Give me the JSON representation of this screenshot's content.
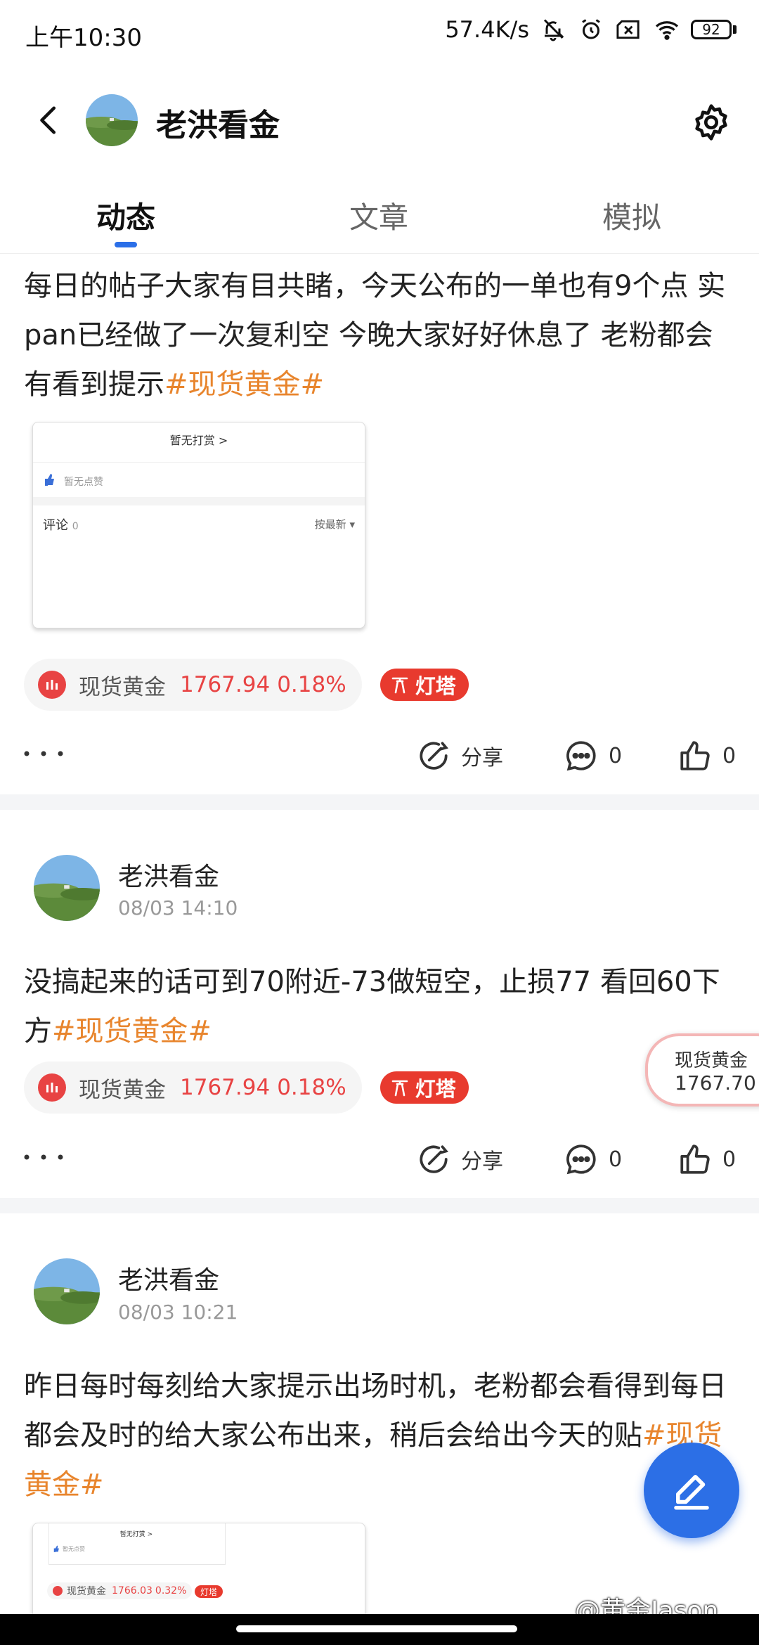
{
  "status_bar": {
    "time": "上午10:30",
    "speed": "57.4K/s",
    "battery": "92"
  },
  "header": {
    "title": "老洪看金"
  },
  "tabs": [
    {
      "label": "动态",
      "active": true
    },
    {
      "label": "文章",
      "active": false
    },
    {
      "label": "模拟",
      "active": false
    }
  ],
  "posts": [
    {
      "text": "每日的帖子大家有目共睹，今天公布的一单也有9个点 实pan已经做了一次复利空 今晚大家好好休息了 老粉都会有看到提示",
      "hashtag": "#现货黄金#",
      "thumbnail": {
        "reward": "暂无打赏 >",
        "likes": "暂无点赞",
        "comments": "评论",
        "comments_count": "0",
        "sort": "按最新"
      },
      "quote": {
        "name": "现货黄金",
        "price": "1767.94",
        "change": "0.18%"
      },
      "lighthouse": "灯塔",
      "share": "分享",
      "comment_count": "0",
      "like_count": "0"
    },
    {
      "author": "老洪看金",
      "time": "08/03 14:10",
      "text": "没搞起来的话可到70附近-73做短空，止损77 看回60下方",
      "hashtag": "#现货黄金#",
      "quote": {
        "name": "现货黄金",
        "price": "1767.94",
        "change": "0.18%"
      },
      "lighthouse": "灯塔",
      "share": "分享",
      "comment_count": "0",
      "like_count": "0"
    },
    {
      "author": "老洪看金",
      "time": "08/03 10:21",
      "text": "昨日每时每刻给大家提示出场时机，老粉都会看得到每日都会及时的给大家公布出来，稍后会给出今天的贴",
      "hashtag": "#现货黄金#",
      "thumbnail": {
        "reward": "暂无打赏 >",
        "likes": "暂无点赞",
        "quote_name": "现货黄金",
        "quote_price": "1766.03",
        "quote_change": "0.32%",
        "lighthouse": "灯塔"
      }
    }
  ],
  "float_price": {
    "label": "现货黄金",
    "value": "1767.70"
  },
  "watermark": "@黄金Jason",
  "colors": {
    "accent": "#2b6fe8",
    "hashtag": "#e8852d",
    "up_red": "#e84343",
    "lighthouse": "#e83a2e"
  }
}
